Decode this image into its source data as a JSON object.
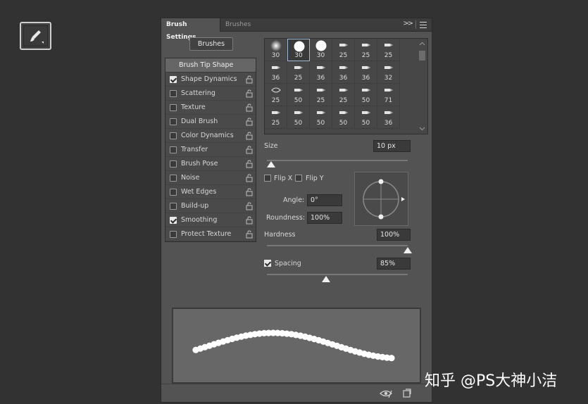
{
  "tool": {
    "icon": "brush-tool-icon"
  },
  "tabs": [
    {
      "label": "Brush Settings",
      "active": true
    },
    {
      "label": "Brushes",
      "active": false
    }
  ],
  "tab_controls": {
    "expand": ">>",
    "menu_icon": "panel-menu-icon"
  },
  "brushes_button": "Brushes",
  "options": {
    "heading": "Brush Tip Shape",
    "items": [
      {
        "label": "Shape Dynamics",
        "checked": true
      },
      {
        "label": "Scattering",
        "checked": false
      },
      {
        "label": "Texture",
        "checked": false
      },
      {
        "label": "Dual Brush",
        "checked": false
      },
      {
        "label": "Color Dynamics",
        "checked": false
      },
      {
        "label": "Transfer",
        "checked": false
      },
      {
        "label": "Brush Pose",
        "checked": false
      },
      {
        "label": "Noise",
        "checked": false
      },
      {
        "label": "Wet Edges",
        "checked": false
      },
      {
        "label": "Build-up",
        "checked": false
      },
      {
        "label": "Smoothing",
        "checked": true
      },
      {
        "label": "Protect Texture",
        "checked": false
      }
    ]
  },
  "presets": {
    "rows": [
      [
        "30",
        "30",
        "30",
        "25",
        "25",
        "25"
      ],
      [
        "36",
        "25",
        "36",
        "36",
        "36",
        "32"
      ],
      [
        "25",
        "50",
        "25",
        "25",
        "50",
        "71"
      ],
      [
        "25",
        "50",
        "50",
        "50",
        "50",
        "36"
      ]
    ],
    "selected_index": 1
  },
  "size": {
    "label": "Size",
    "value": "10 px",
    "level": 0.03
  },
  "flip": {
    "x_label": "Flip X",
    "y_label": "Flip Y",
    "x": false,
    "y": false
  },
  "angle": {
    "label": "Angle:",
    "value": "0°"
  },
  "roundness": {
    "label": "Roundness:",
    "value": "100%"
  },
  "hardness": {
    "label": "Hardness",
    "value": "100%",
    "level": 1.0
  },
  "spacing": {
    "label": "Spacing",
    "value": "85%",
    "checked": true,
    "level": 0.42
  },
  "footer": {
    "icons": [
      "eye-icon",
      "new-preset-icon"
    ]
  },
  "watermark": "知乎 @PS大神小洁"
}
